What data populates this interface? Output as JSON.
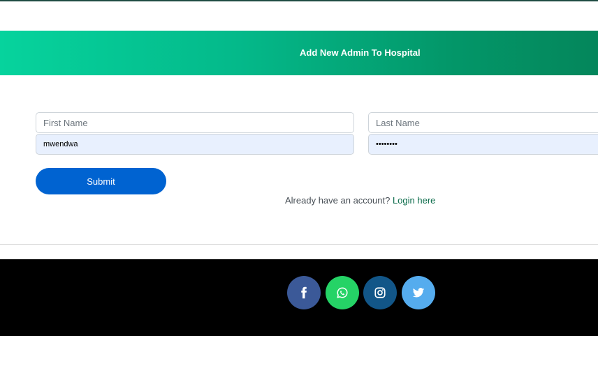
{
  "header": {
    "title": "Add New Admin To Hospital"
  },
  "form": {
    "first_name_placeholder": "First Name",
    "last_name_placeholder": "Last Name",
    "username_value": "mwendwa",
    "password_value": "••••••••",
    "submit_label": "Submit",
    "login_prompt": "Already have an account?",
    "login_link": "Login here"
  },
  "footer": {
    "social": [
      {
        "icon": "facebook-icon",
        "color": "#3b5998"
      },
      {
        "icon": "whatsapp-icon",
        "color": "#25d366"
      },
      {
        "icon": "instagram-icon",
        "color": "#125688"
      },
      {
        "icon": "twitter-icon",
        "color": "#55acee"
      }
    ]
  },
  "colors": {
    "banner_start": "#06d39d",
    "banner_end": "#04865b",
    "submit": "#0063d1",
    "link": "#0a6b4a"
  }
}
